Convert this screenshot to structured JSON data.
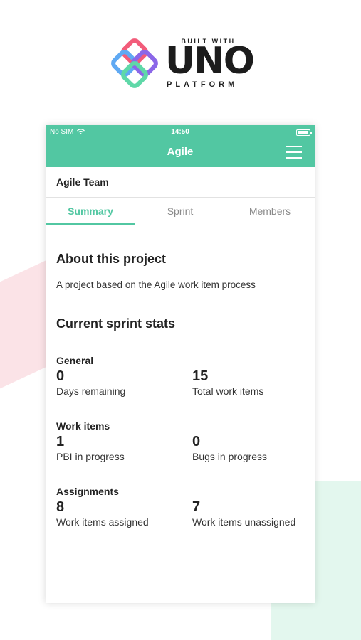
{
  "brand": {
    "built_with": "BUILT WITH",
    "name": "UNO",
    "platform": "PLATFORM"
  },
  "status_bar": {
    "carrier": "No SIM",
    "time": "14:50",
    "battery_level": 0.85
  },
  "appbar": {
    "title": "Agile",
    "menu_icon": "hamburger-icon"
  },
  "team": {
    "name": "Agile Team"
  },
  "tabs": [
    {
      "label": "Summary",
      "active": true
    },
    {
      "label": "Sprint",
      "active": false
    },
    {
      "label": "Members",
      "active": false
    }
  ],
  "about": {
    "title": "About this project",
    "description": "A project based on the Agile work item process"
  },
  "sprint_stats": {
    "title": "Current sprint stats",
    "groups": [
      {
        "title": "General",
        "stats": [
          {
            "value": "0",
            "label": "Days remaining"
          },
          {
            "value": "15",
            "label": "Total work items"
          }
        ]
      },
      {
        "title": "Work items",
        "stats": [
          {
            "value": "1",
            "label": "PBI in progress"
          },
          {
            "value": "0",
            "label": "Bugs in progress"
          }
        ]
      },
      {
        "title": "Assignments",
        "stats": [
          {
            "value": "8",
            "label": "Work items assigned"
          },
          {
            "value": "7",
            "label": "Work items unassigned"
          }
        ]
      }
    ]
  },
  "colors": {
    "accent": "#52c7a2",
    "background_pink": "#fbe3e7",
    "background_mint": "#e3f7ee"
  }
}
